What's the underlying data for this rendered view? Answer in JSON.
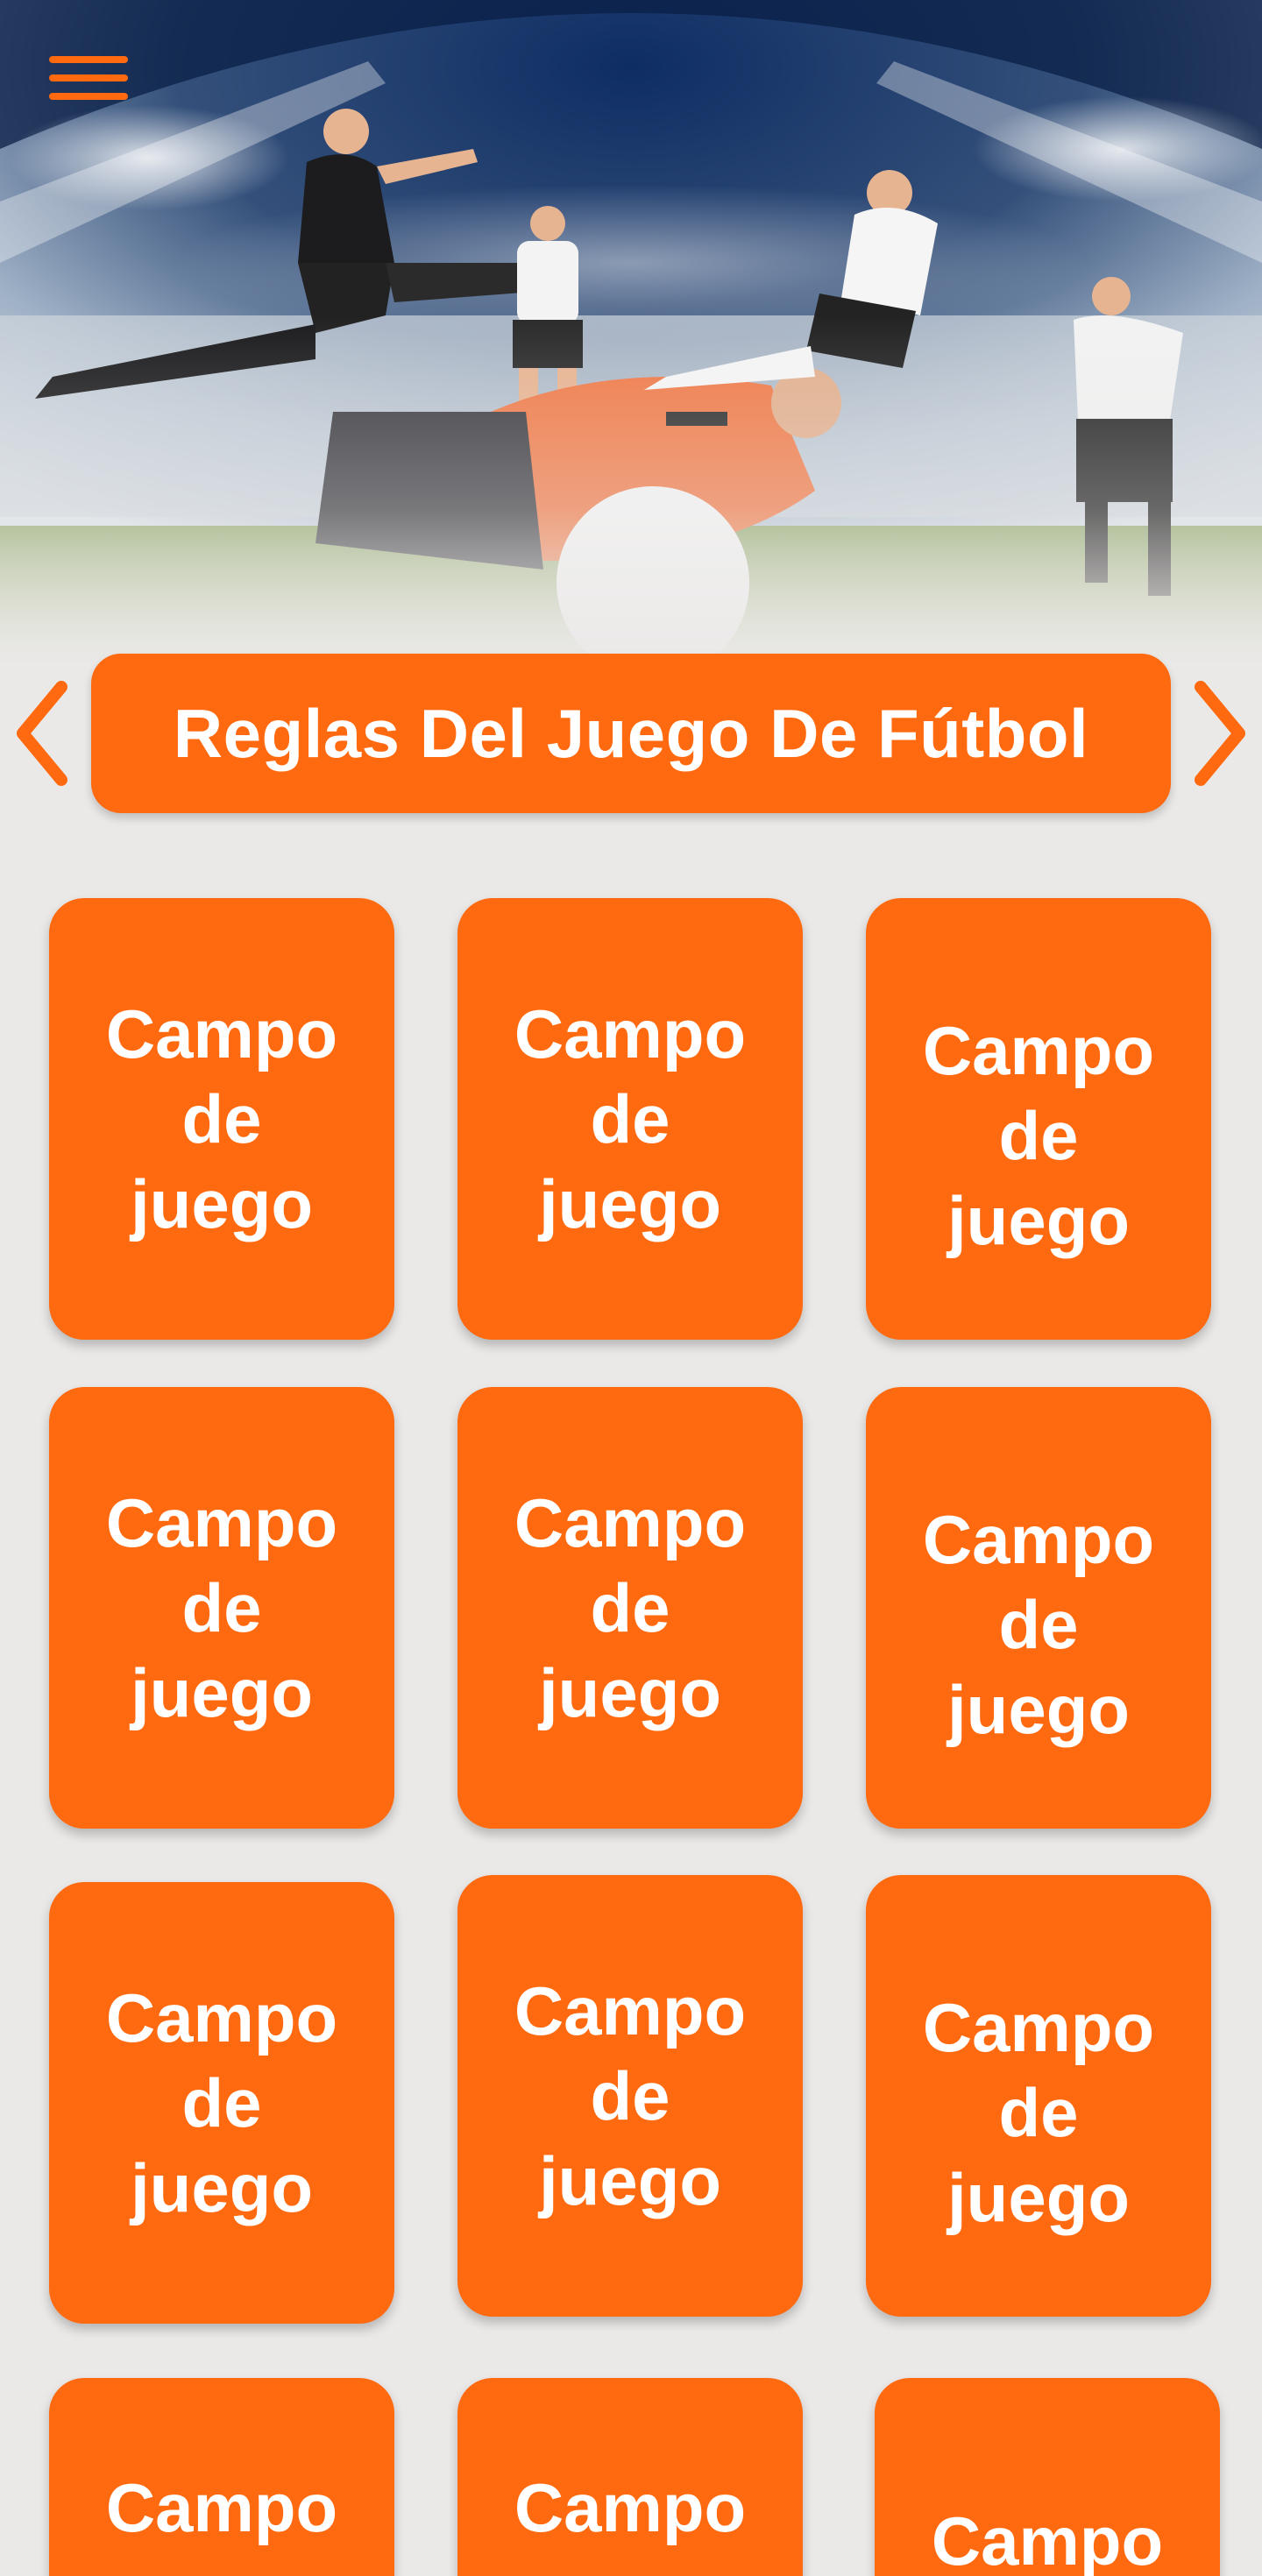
{
  "header": {
    "menu_icon": "hamburger-menu-icon",
    "hero_image": "soccer-players-stadium-illustration"
  },
  "title_bar": {
    "title": "Reglas Del Juego De Fútbol",
    "prev_icon": "chevron-left-icon",
    "next_icon": "chevron-right-icon"
  },
  "colors": {
    "accent": "#ff6a10",
    "background": "#ebe9e8",
    "text_on_accent": "#ffffff"
  },
  "rules": [
    {
      "label": "Campo de juego"
    },
    {
      "label": "Campo de juego"
    },
    {
      "label": "Campo de juego"
    },
    {
      "label": "Campo de juego"
    },
    {
      "label": "Campo de juego"
    },
    {
      "label": "Campo de juego"
    },
    {
      "label": "Campo de juego"
    },
    {
      "label": "Campo de juego"
    },
    {
      "label": "Campo de juego"
    },
    {
      "label": "Campo"
    },
    {
      "label": "Campo"
    },
    {
      "label": "Campo"
    }
  ]
}
